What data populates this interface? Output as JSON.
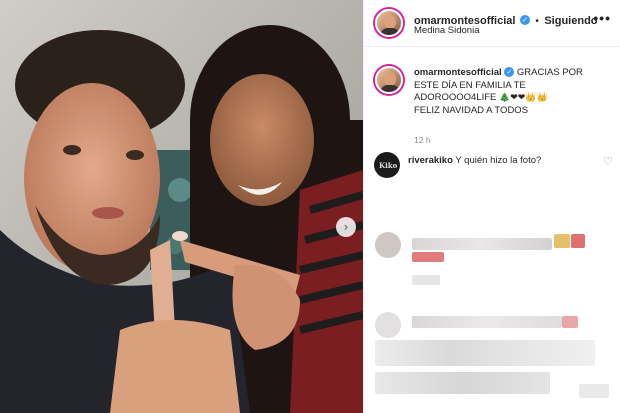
{
  "header": {
    "username": "omarmontesofficial",
    "verified_mark": "✓",
    "separator": "•",
    "follow_label": "Siguiendo",
    "location": "Medina Sidonia",
    "more_label": "•••"
  },
  "caption": {
    "username": "omarmontesofficial",
    "verified_mark": "✓",
    "text_line1": "GRACIAS POR ESTE DÍA EN FAMILIA TE ADOROOOO4LIFE",
    "emoji": "🎄❤❤👑👑",
    "text_line2": "FELIZ NAVIDAD A TODOS",
    "time": "12 h"
  },
  "comments": [
    {
      "username": "riverakiko",
      "text": "Y quién hizo la foto?",
      "avatar_text": "Kiko"
    }
  ],
  "icons": {
    "next_arrow": "›",
    "heart": "♡"
  },
  "colors": {
    "verified": "#3897f0",
    "story_ring": "#d6249f",
    "muted": "#8e8e8e"
  }
}
